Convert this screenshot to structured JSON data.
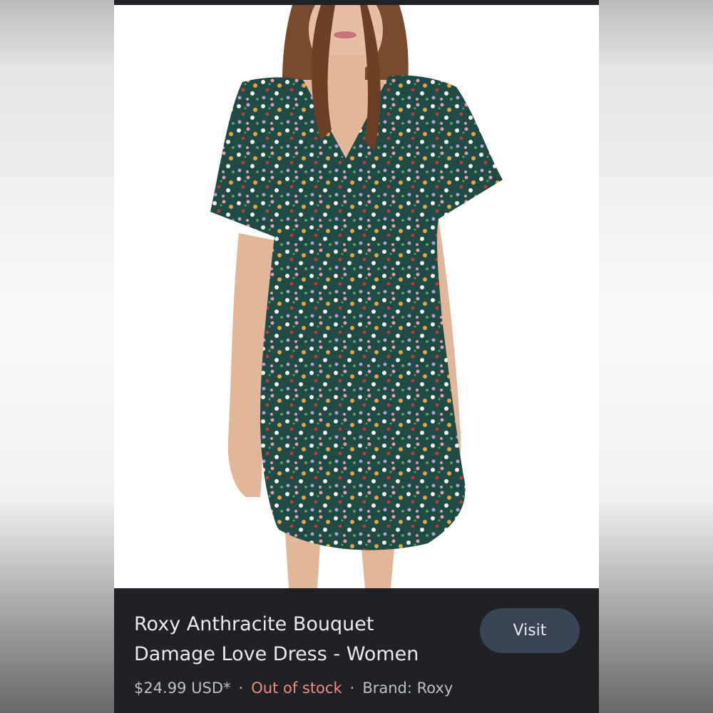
{
  "product": {
    "title_line1": "Roxy Anthracite Bouquet",
    "title_line2": "Damage Love Dress - Women",
    "price": "$24.99 USD*",
    "separator": "·",
    "stock_status": "Out of stock",
    "brand": "Brand: Roxy",
    "visit_label": "Visit"
  },
  "colors": {
    "card_background": "#202124",
    "visit_button": "#394457",
    "out_of_stock": "#f28b82",
    "dress_base": "#1f4a45"
  },
  "icons": {
    "image": "product-photo"
  }
}
